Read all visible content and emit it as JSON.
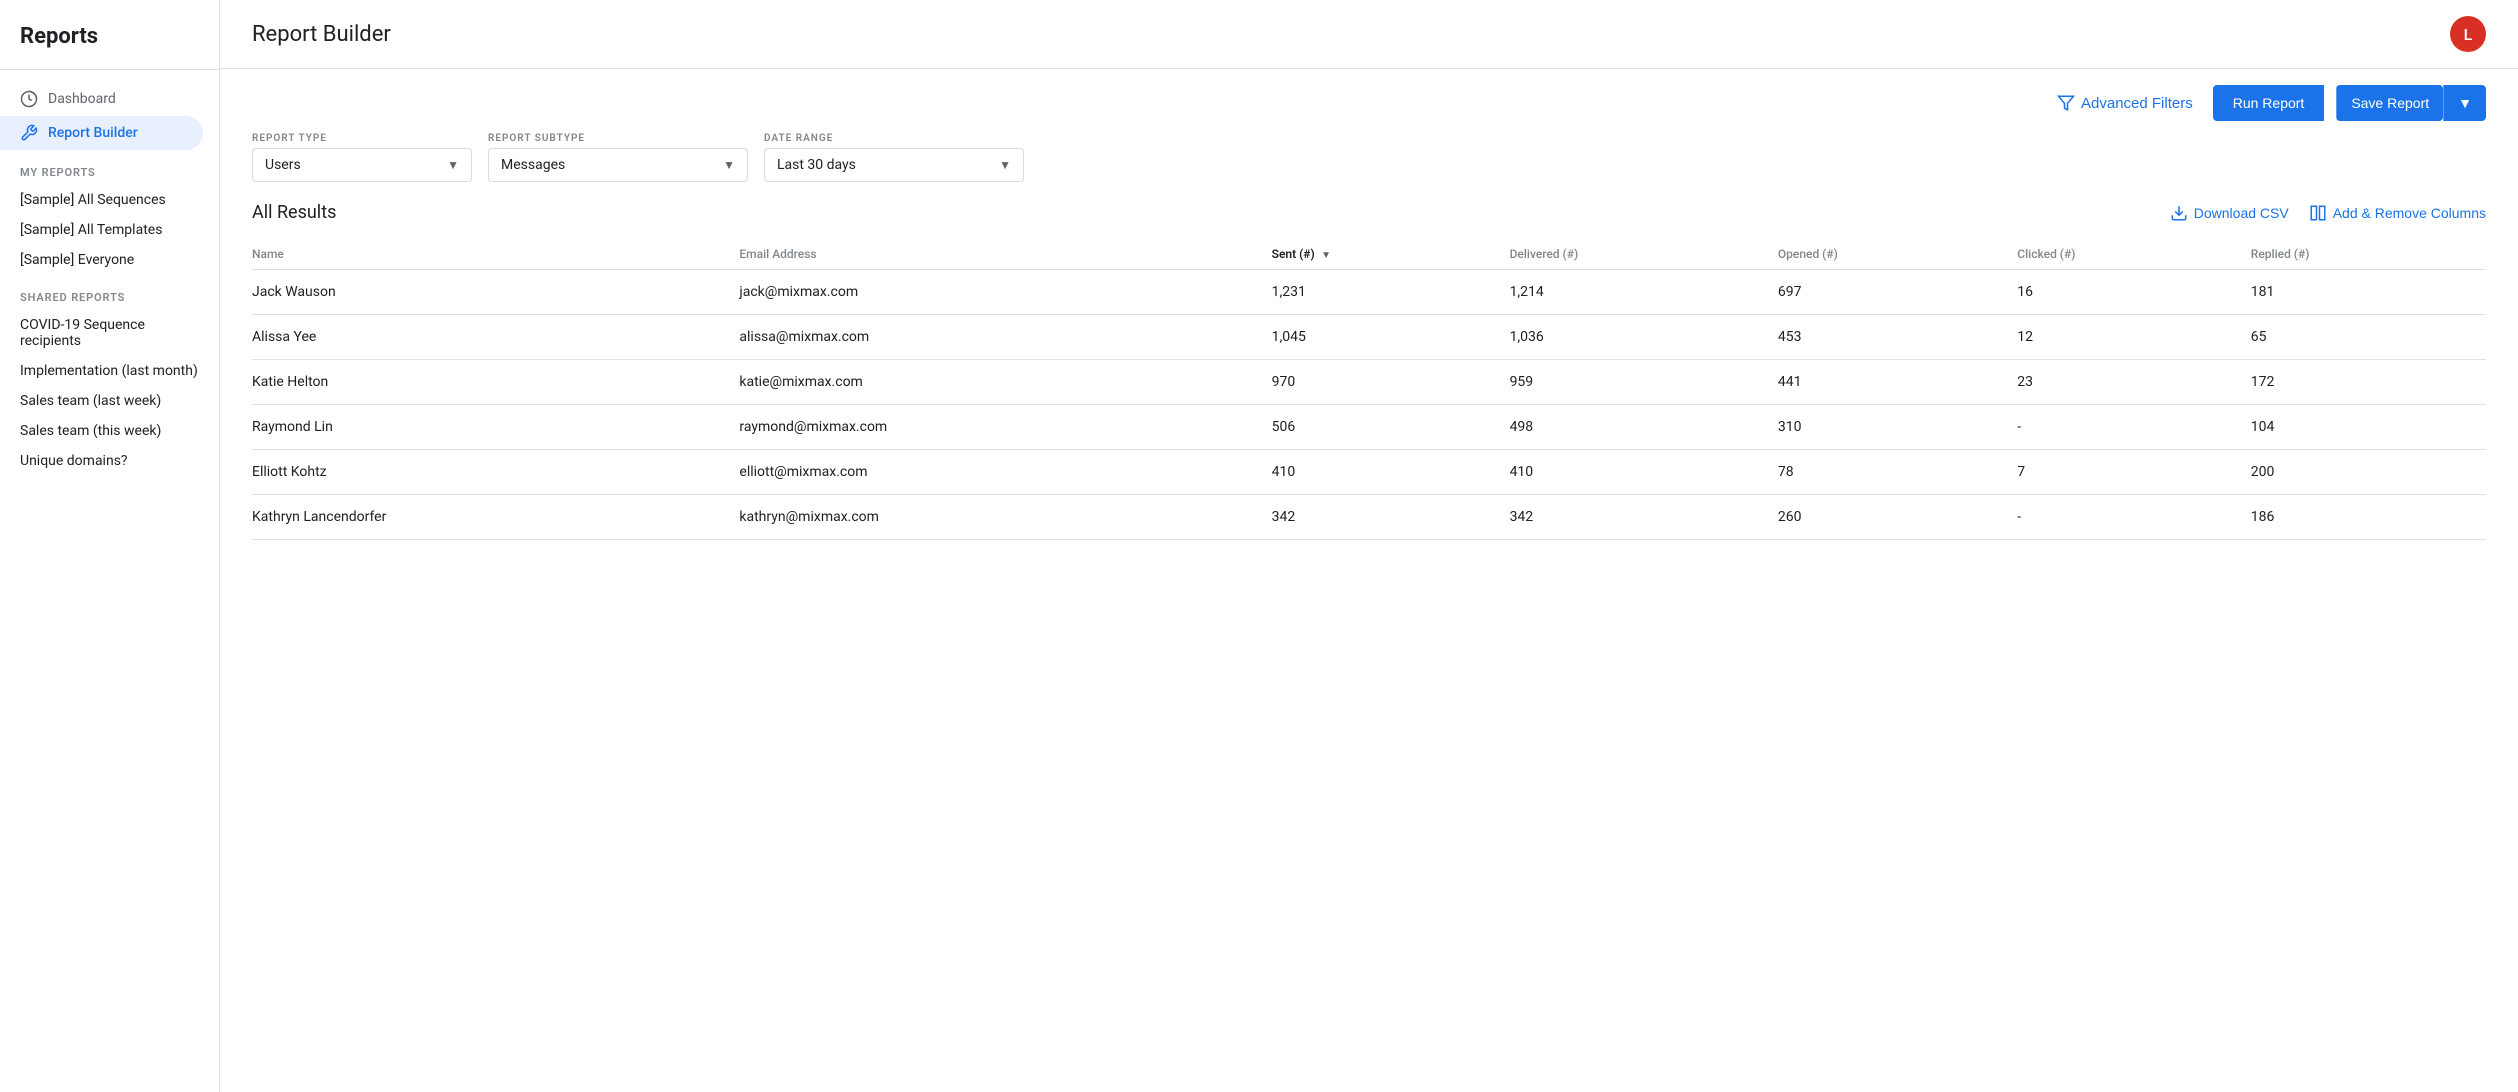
{
  "app": {
    "title": "Reports",
    "avatar_letter": "L"
  },
  "sidebar": {
    "nav_items": [
      {
        "id": "dashboard",
        "label": "Dashboard",
        "icon": "⊙",
        "active": false
      },
      {
        "id": "report-builder",
        "label": "Report Builder",
        "icon": "🔧",
        "active": true
      }
    ],
    "my_reports_label": "MY REPORTS",
    "my_reports": [
      {
        "id": "sample-all-sequences",
        "label": "[Sample] All Sequences"
      },
      {
        "id": "sample-all-templates",
        "label": "[Sample] All Templates"
      },
      {
        "id": "sample-everyone",
        "label": "[Sample] Everyone"
      }
    ],
    "shared_reports_label": "SHARED REPORTS",
    "shared_reports": [
      {
        "id": "covid19",
        "label": "COVID-19 Sequence recipients"
      },
      {
        "id": "implementation",
        "label": "Implementation (last month)"
      },
      {
        "id": "sales-last-week",
        "label": "Sales team (last week)"
      },
      {
        "id": "sales-this-week",
        "label": "Sales team (this week)"
      },
      {
        "id": "unique-domains",
        "label": "Unique domains?"
      }
    ]
  },
  "header": {
    "title": "Report Builder"
  },
  "toolbar": {
    "advanced_filters_label": "Advanced Filters",
    "run_report_label": "Run Report",
    "save_report_label": "Save Report"
  },
  "filters": {
    "report_type_label": "REPORT TYPE",
    "report_type_value": "Users",
    "report_subtype_label": "REPORT SUBTYPE",
    "report_subtype_value": "Messages",
    "date_range_label": "DATE RANGE",
    "date_range_value": "Last 30 days"
  },
  "results": {
    "title": "All Results",
    "download_csv_label": "Download CSV",
    "add_remove_columns_label": "Add & Remove Columns",
    "columns": [
      {
        "id": "name",
        "label": "Name",
        "sorted": false
      },
      {
        "id": "email",
        "label": "Email Address",
        "sorted": false
      },
      {
        "id": "sent",
        "label": "Sent (#)",
        "sorted": true
      },
      {
        "id": "delivered",
        "label": "Delivered (#)",
        "sorted": false
      },
      {
        "id": "opened",
        "label": "Opened (#)",
        "sorted": false
      },
      {
        "id": "clicked",
        "label": "Clicked (#)",
        "sorted": false
      },
      {
        "id": "replied",
        "label": "Replied (#)",
        "sorted": false
      }
    ],
    "rows": [
      {
        "name": "Jack Wauson",
        "email": "jack@mixmax.com",
        "sent": "1,231",
        "delivered": "1,214",
        "opened": "697",
        "clicked": "16",
        "replied": "181"
      },
      {
        "name": "Alissa Yee",
        "email": "alissa@mixmax.com",
        "sent": "1,045",
        "delivered": "1,036",
        "opened": "453",
        "clicked": "12",
        "replied": "65"
      },
      {
        "name": "Katie Helton",
        "email": "katie@mixmax.com",
        "sent": "970",
        "delivered": "959",
        "opened": "441",
        "clicked": "23",
        "replied": "172"
      },
      {
        "name": "Raymond Lin",
        "email": "raymond@mixmax.com",
        "sent": "506",
        "delivered": "498",
        "opened": "310",
        "clicked": "-",
        "replied": "104"
      },
      {
        "name": "Elliott Kohtz",
        "email": "elliott@mixmax.com",
        "sent": "410",
        "delivered": "410",
        "opened": "78",
        "clicked": "7",
        "replied": "200"
      },
      {
        "name": "Kathryn Lancendorfer",
        "email": "kathryn@mixmax.com",
        "sent": "342",
        "delivered": "342",
        "opened": "260",
        "clicked": "-",
        "replied": "186"
      }
    ]
  }
}
